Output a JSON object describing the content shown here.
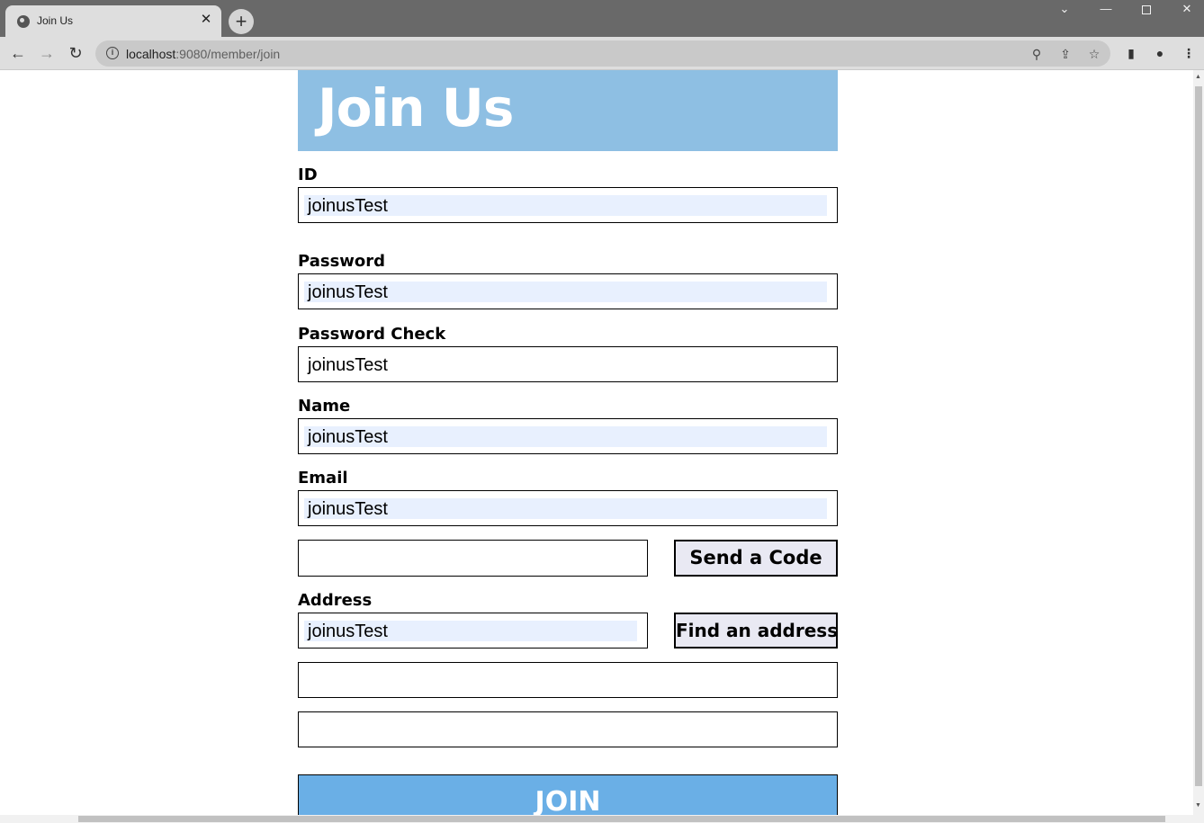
{
  "browser": {
    "tab_title": "Join Us",
    "tab_close": "✕",
    "new_tab": "+",
    "url_host": "localhost",
    "url_rest": ":9080/member/join",
    "icons": {
      "back": "←",
      "forward": "→",
      "reload": "↻",
      "zoom": "⚲",
      "share": "⇪",
      "star": "☆",
      "side_panel": "▮",
      "profile": "●",
      "menu": "⋮",
      "info": "i",
      "minimize": "—",
      "chevron": "⌄",
      "close_window": "✕"
    }
  },
  "page": {
    "heading": "Join Us",
    "fields": {
      "id": {
        "label": "ID",
        "value": "joinusTest"
      },
      "password": {
        "label": "Password",
        "value": "joinusTest"
      },
      "password_check": {
        "label": "Password Check",
        "value": "joinusTest"
      },
      "name": {
        "label": "Name",
        "value": "joinusTest"
      },
      "email": {
        "label": "Email",
        "value": "joinusTest"
      },
      "email_code": {
        "value": ""
      },
      "address": {
        "label": "Address",
        "value": "joinusTest"
      },
      "address_detail_1": {
        "value": ""
      },
      "address_detail_2": {
        "value": ""
      }
    },
    "buttons": {
      "send_code": "Send a Code",
      "find_address": "Find an address",
      "join": "JOIN"
    },
    "colors": {
      "banner": "#8ebfe3",
      "join_button": "#6aafe6",
      "autofill": "#e8f0fe"
    }
  }
}
